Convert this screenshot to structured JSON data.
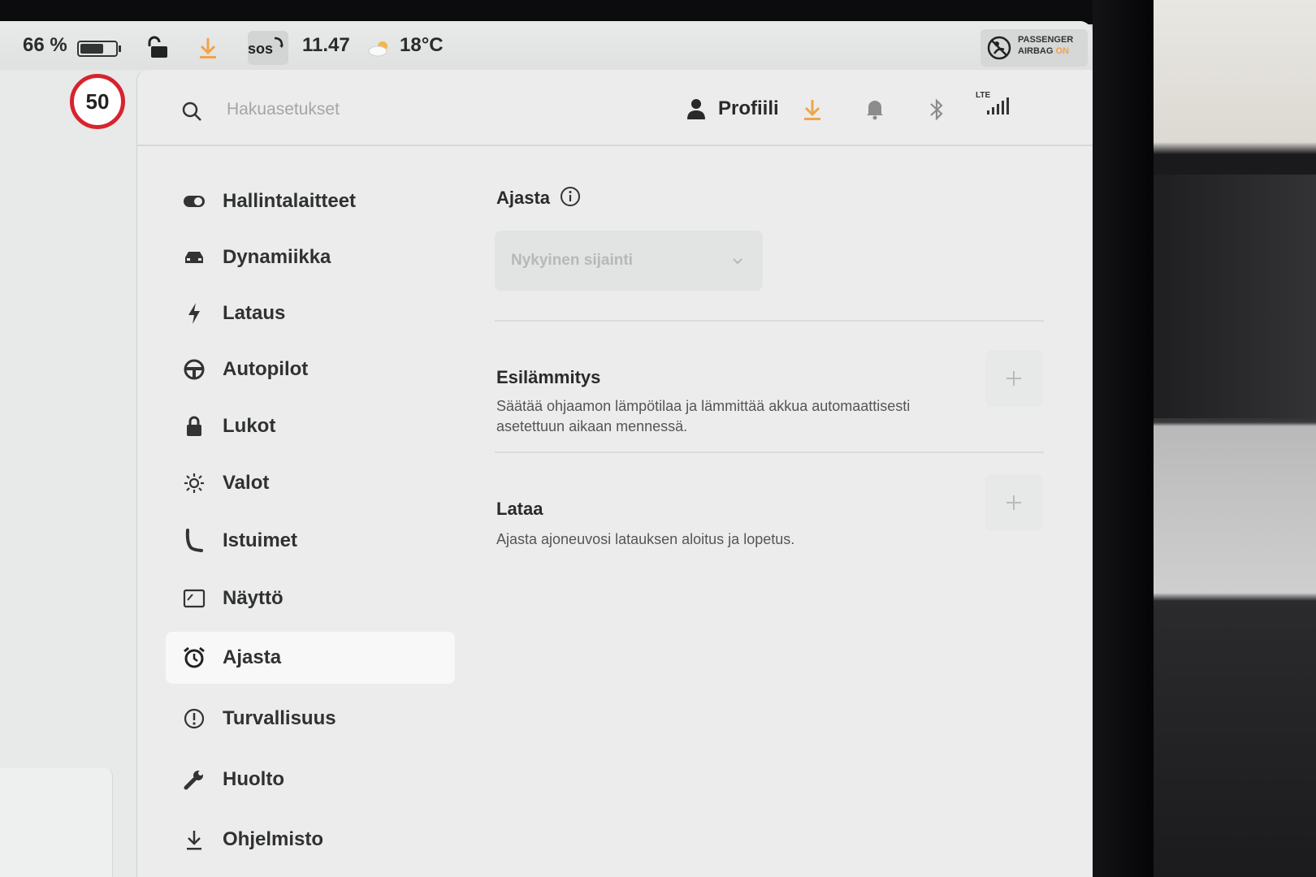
{
  "status_bar": {
    "battery_percent": "66 %",
    "battery_level": 0.66,
    "sos_label": "sos",
    "time": "11.47",
    "temperature": "18°C",
    "airbag_line1": "PASSENGER",
    "airbag_line2": "AIRBAG",
    "airbag_state": "ON",
    "accent_orange": "#f0a44a"
  },
  "speed_limit": "50",
  "header": {
    "search_placeholder": "Hakuasetukset",
    "profile_label": "Profiili",
    "lte_label": "LTE"
  },
  "menu": {
    "items": [
      {
        "label": "Hallintalaitteet",
        "icon": "toggle-icon"
      },
      {
        "label": "Dynamiikka",
        "icon": "car-icon"
      },
      {
        "label": "Lataus",
        "icon": "bolt-icon"
      },
      {
        "label": "Autopilot",
        "icon": "steering-wheel-icon"
      },
      {
        "label": "Lukot",
        "icon": "lock-icon"
      },
      {
        "label": "Valot",
        "icon": "sun-icon"
      },
      {
        "label": "Istuimet",
        "icon": "seat-icon"
      },
      {
        "label": "Näyttö",
        "icon": "display-icon"
      },
      {
        "label": "Ajasta",
        "icon": "alarm-clock-icon",
        "active": true
      },
      {
        "label": "Turvallisuus",
        "icon": "alert-circle-icon"
      },
      {
        "label": "Huolto",
        "icon": "wrench-icon"
      },
      {
        "label": "Ohjelmisto",
        "icon": "download-icon"
      }
    ]
  },
  "content": {
    "title": "Ajasta",
    "location_dropdown": "Nykyinen sijainti",
    "preheat_title": "Esilämmitys",
    "preheat_desc_line1": "Säätää ohjaamon lämpötilaa ja lämmittää akkua automaattisesti",
    "preheat_desc_line2": "asetettuun aikaan mennessä.",
    "charge_title": "Lataa",
    "charge_desc": "Ajasta ajoneuvosi latauksen aloitus ja lopetus."
  }
}
